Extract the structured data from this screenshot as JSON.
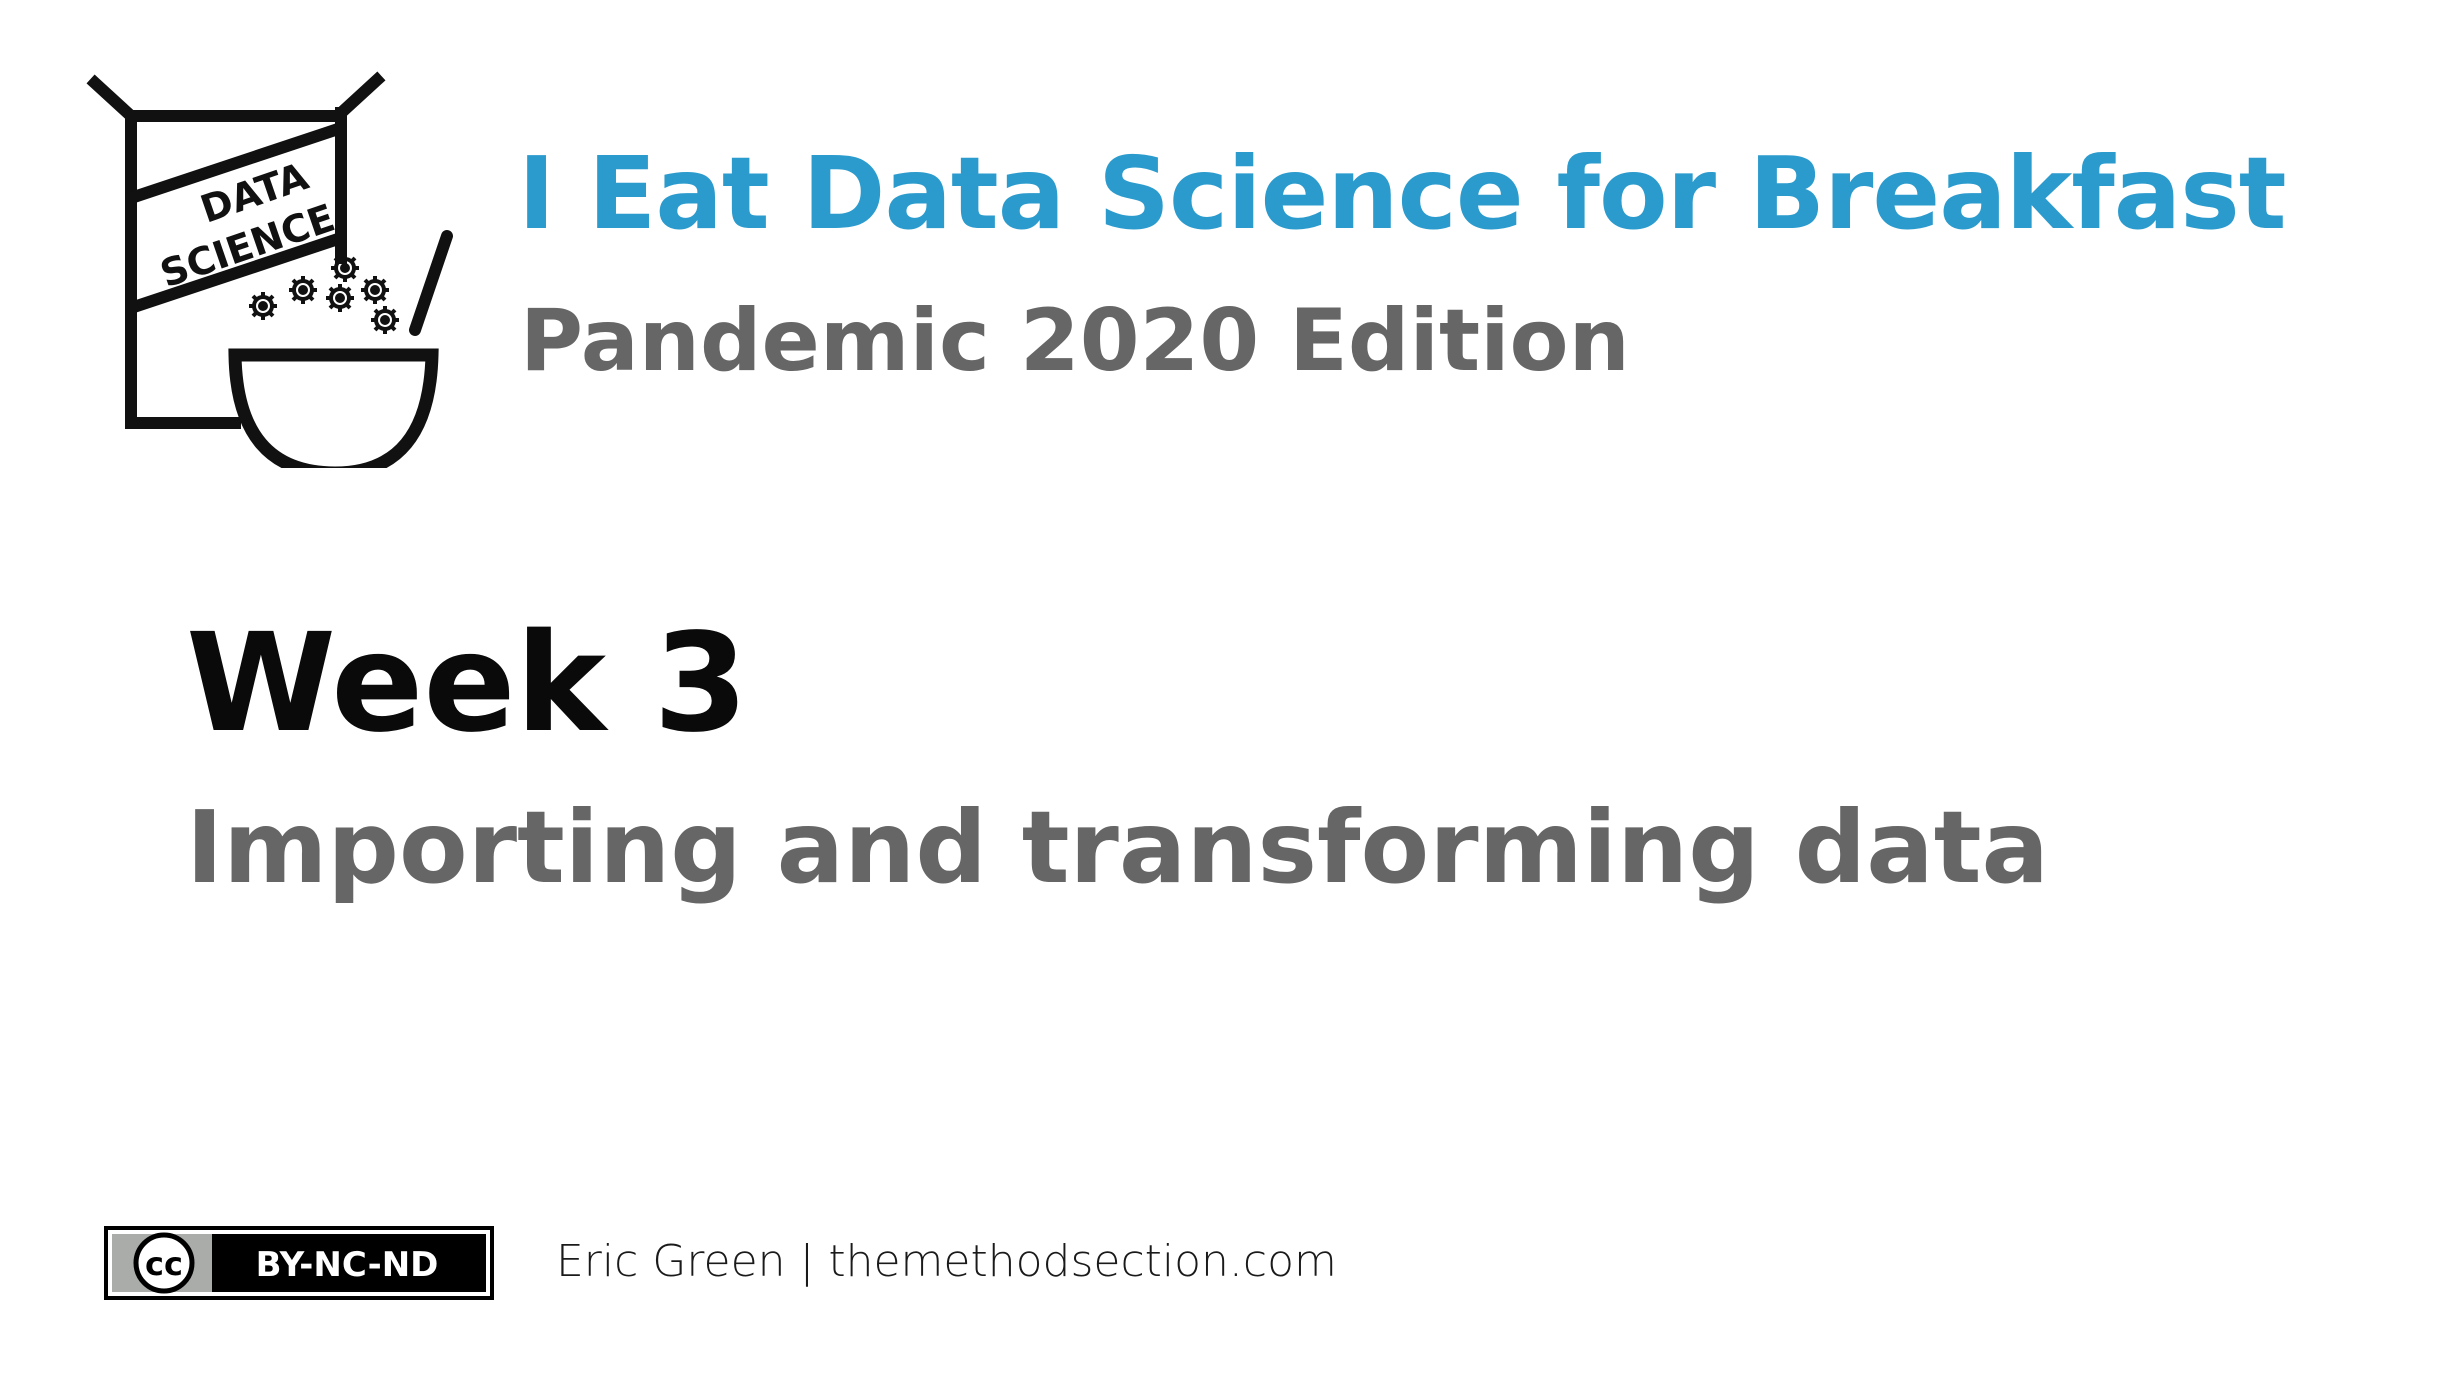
{
  "logo": {
    "box_text": [
      "DATA",
      "SCIENCE"
    ],
    "icon": "cereal-box-bowl-icon"
  },
  "header": {
    "title": "I Eat Data Science for Breakfast",
    "subtitle": "Pandemic 2020 Edition"
  },
  "main": {
    "week_title": "Week 3",
    "week_subtitle": "Importing and transforming data"
  },
  "footer": {
    "license_symbol": "cc",
    "license_label": "BY-NC-ND",
    "credit": "Eric Green | themethodsection.com"
  },
  "colors": {
    "accent": "#2b9bcd",
    "subtitle_gray": "#666666",
    "heading_black": "#0a0a0a",
    "logo_stroke": "#111111"
  }
}
